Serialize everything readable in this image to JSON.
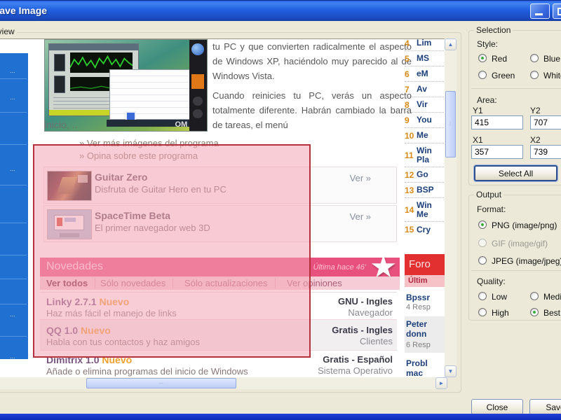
{
  "window": {
    "title": "Save Image"
  },
  "colors": {
    "selection_border": "#b4303c",
    "selection_fill": "#f4a4b4",
    "novedades_pink": "#e8517e",
    "foros_red": "#e23030",
    "sidebar_blue": "#2070d2",
    "titlebar_blue": "#2160e0"
  },
  "icons": {
    "star": "★",
    "up_arrow": "▲",
    "down_arrow": "▼",
    "right_arrow": "►",
    "grip_v": "⁞",
    "grip_h": "⋯"
  },
  "preview": {
    "label": "Preview"
  },
  "selection_panel": {
    "title": "Selection",
    "style_label": "Style:",
    "styles": [
      {
        "label": "Red",
        "selected": true
      },
      {
        "label": "Blue",
        "selected": false
      },
      {
        "label": "Green",
        "selected": false
      },
      {
        "label": "White",
        "selected": false
      }
    ],
    "area_label": "Area:",
    "fields": [
      {
        "label": "Y1",
        "value": "415"
      },
      {
        "label": "Y2",
        "value": "707"
      },
      {
        "label": "X1",
        "value": "357"
      },
      {
        "label": "X2",
        "value": "739"
      }
    ],
    "select_all_label": "Select All"
  },
  "output_panel": {
    "title": "Output",
    "format_label": "Format:",
    "formats": [
      {
        "label": "PNG (image/png)",
        "selected": true,
        "disabled": false
      },
      {
        "label": "GIF (image/gif)",
        "selected": false,
        "disabled": true
      },
      {
        "label": "JPEG (image/jpeg)",
        "selected": false,
        "disabled": false
      }
    ],
    "quality_label": "Quality:",
    "qualities": [
      {
        "label": "Low",
        "selected": false
      },
      {
        "label": "Medium",
        "selected": false
      },
      {
        "label": "High",
        "selected": false
      },
      {
        "label": "Best",
        "selected": true
      }
    ]
  },
  "actions": {
    "close": "Close",
    "save": "Save"
  },
  "webpage": {
    "sidebar_items": [
      "...",
      "...",
      "...",
      "...",
      "..."
    ],
    "image_watermark": "OM",
    "paragraph1": "tu PC y que convierten radicalmente el aspecto de Windows XP, haciéndolo muy parecido al de Windows Vista.",
    "paragraph2": "Cuando reinicies tu PC, verás un aspecto totalmente diferente. Habrán cambiado la barra de tareas, el menú",
    "paragraph3": "inicio, ..",
    "links": [
      "» Ver más imágenes del programa",
      "» Opina sobre este programa"
    ],
    "apps": [
      {
        "name": "Guitar Zero",
        "desc": "Disfruta de Guitar Hero en tu PC",
        "action": "Ver »"
      },
      {
        "name": "SpaceTime Beta",
        "desc": "El primer navegador web 3D",
        "action": "Ver »"
      }
    ],
    "novedades": {
      "title": "Novedades",
      "last_update": "Última hace 46'",
      "tabs": [
        "Ver todos",
        "Sólo novedades",
        "Sólo actualizaciones",
        "Ver opiniones"
      ]
    },
    "news": [
      {
        "name": "Linky 2.7.1",
        "badge": "Nuevo",
        "desc": "Haz más fácil el manejo de links",
        "license": "GNU - Ingles",
        "category": "Navegador"
      },
      {
        "name": "QQ 1.0",
        "badge": "Nuevo",
        "desc": "Habla con tus contactos y haz amigos",
        "license": "Gratis - Ingles",
        "category": "Clientes"
      },
      {
        "name": "Dimitrix 1.0",
        "badge": "Nuevo",
        "desc": "Añade o elimina programas del inicio de Windows",
        "license": "Gratis - Español",
        "category": "Sistema Operativo"
      }
    ],
    "ranking": [
      {
        "n": "4",
        "t": "Lim"
      },
      {
        "n": "5",
        "t": "MS"
      },
      {
        "n": "6",
        "t": "eM"
      },
      {
        "n": "7",
        "t": "Av"
      },
      {
        "n": "8",
        "t": "Vir"
      },
      {
        "n": "9",
        "t": "You"
      },
      {
        "n": "10",
        "t": "Me"
      },
      {
        "n": "11",
        "t": "Win Pla"
      },
      {
        "n": "12",
        "t": "Go"
      },
      {
        "n": "13",
        "t": "BSP"
      },
      {
        "n": "14",
        "t": "Win Me"
      },
      {
        "n": "15",
        "t": "Cry"
      }
    ],
    "foros": {
      "title": "Foro",
      "subtitle": "Últim",
      "threads": [
        {
          "name": "Bpssr",
          "replies": "4 Resp"
        },
        {
          "name": "Peter donn",
          "replies": "6 Resp"
        },
        {
          "name": "Probl mac",
          "replies": ""
        }
      ]
    }
  }
}
